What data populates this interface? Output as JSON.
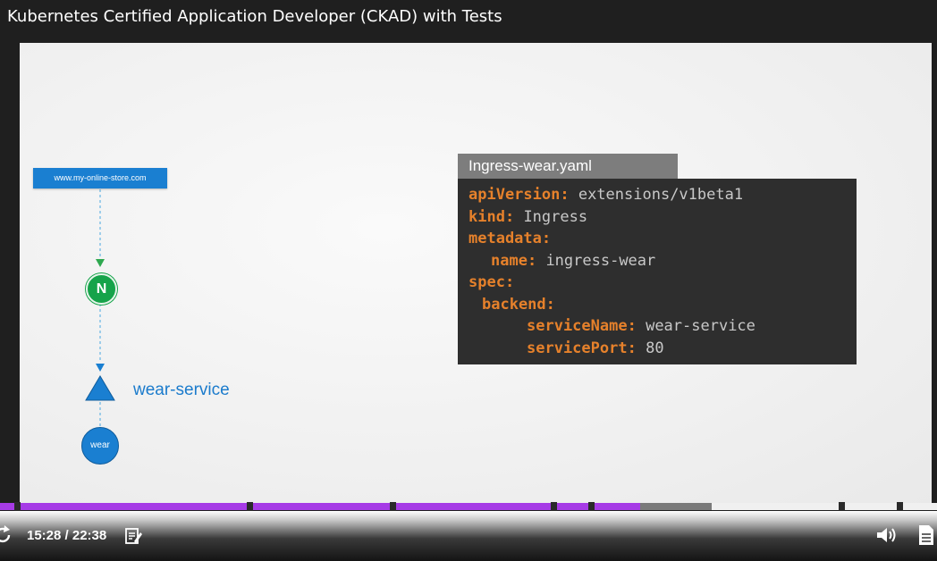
{
  "window": {
    "title": "Kubernetes Certified Application Developer (CKAD) with Tests"
  },
  "diagram": {
    "url_label": "www.my-online-store.com",
    "nginx_letter": "N",
    "service_label": "wear-service",
    "pod_label": "wear"
  },
  "yaml": {
    "filename": "Ingress-wear.yaml",
    "lines": [
      {
        "key": "apiVersion:",
        "value": "extensions/v1beta1"
      },
      {
        "key": "kind:",
        "value": "Ingress"
      },
      {
        "key": "metadata:",
        "value": ""
      },
      {
        "key": "name:",
        "value": "ingress-wear"
      },
      {
        "key": "spec:",
        "value": ""
      },
      {
        "key": "backend:",
        "value": ""
      },
      {
        "key": "serviceName:",
        "value": "wear-service"
      },
      {
        "key": "servicePort:",
        "value": "80"
      }
    ]
  },
  "player": {
    "time_display": "15:28 / 22:38",
    "played_fraction": 0.683,
    "buffered_fraction": 0.76,
    "icons": {
      "replay": "replay-icon",
      "notes": "notes-icon",
      "volume": "volume-icon",
      "transcript": "transcript-icon"
    },
    "colors": {
      "played": "#a63be6",
      "buffered": "#7a7a7a"
    }
  }
}
